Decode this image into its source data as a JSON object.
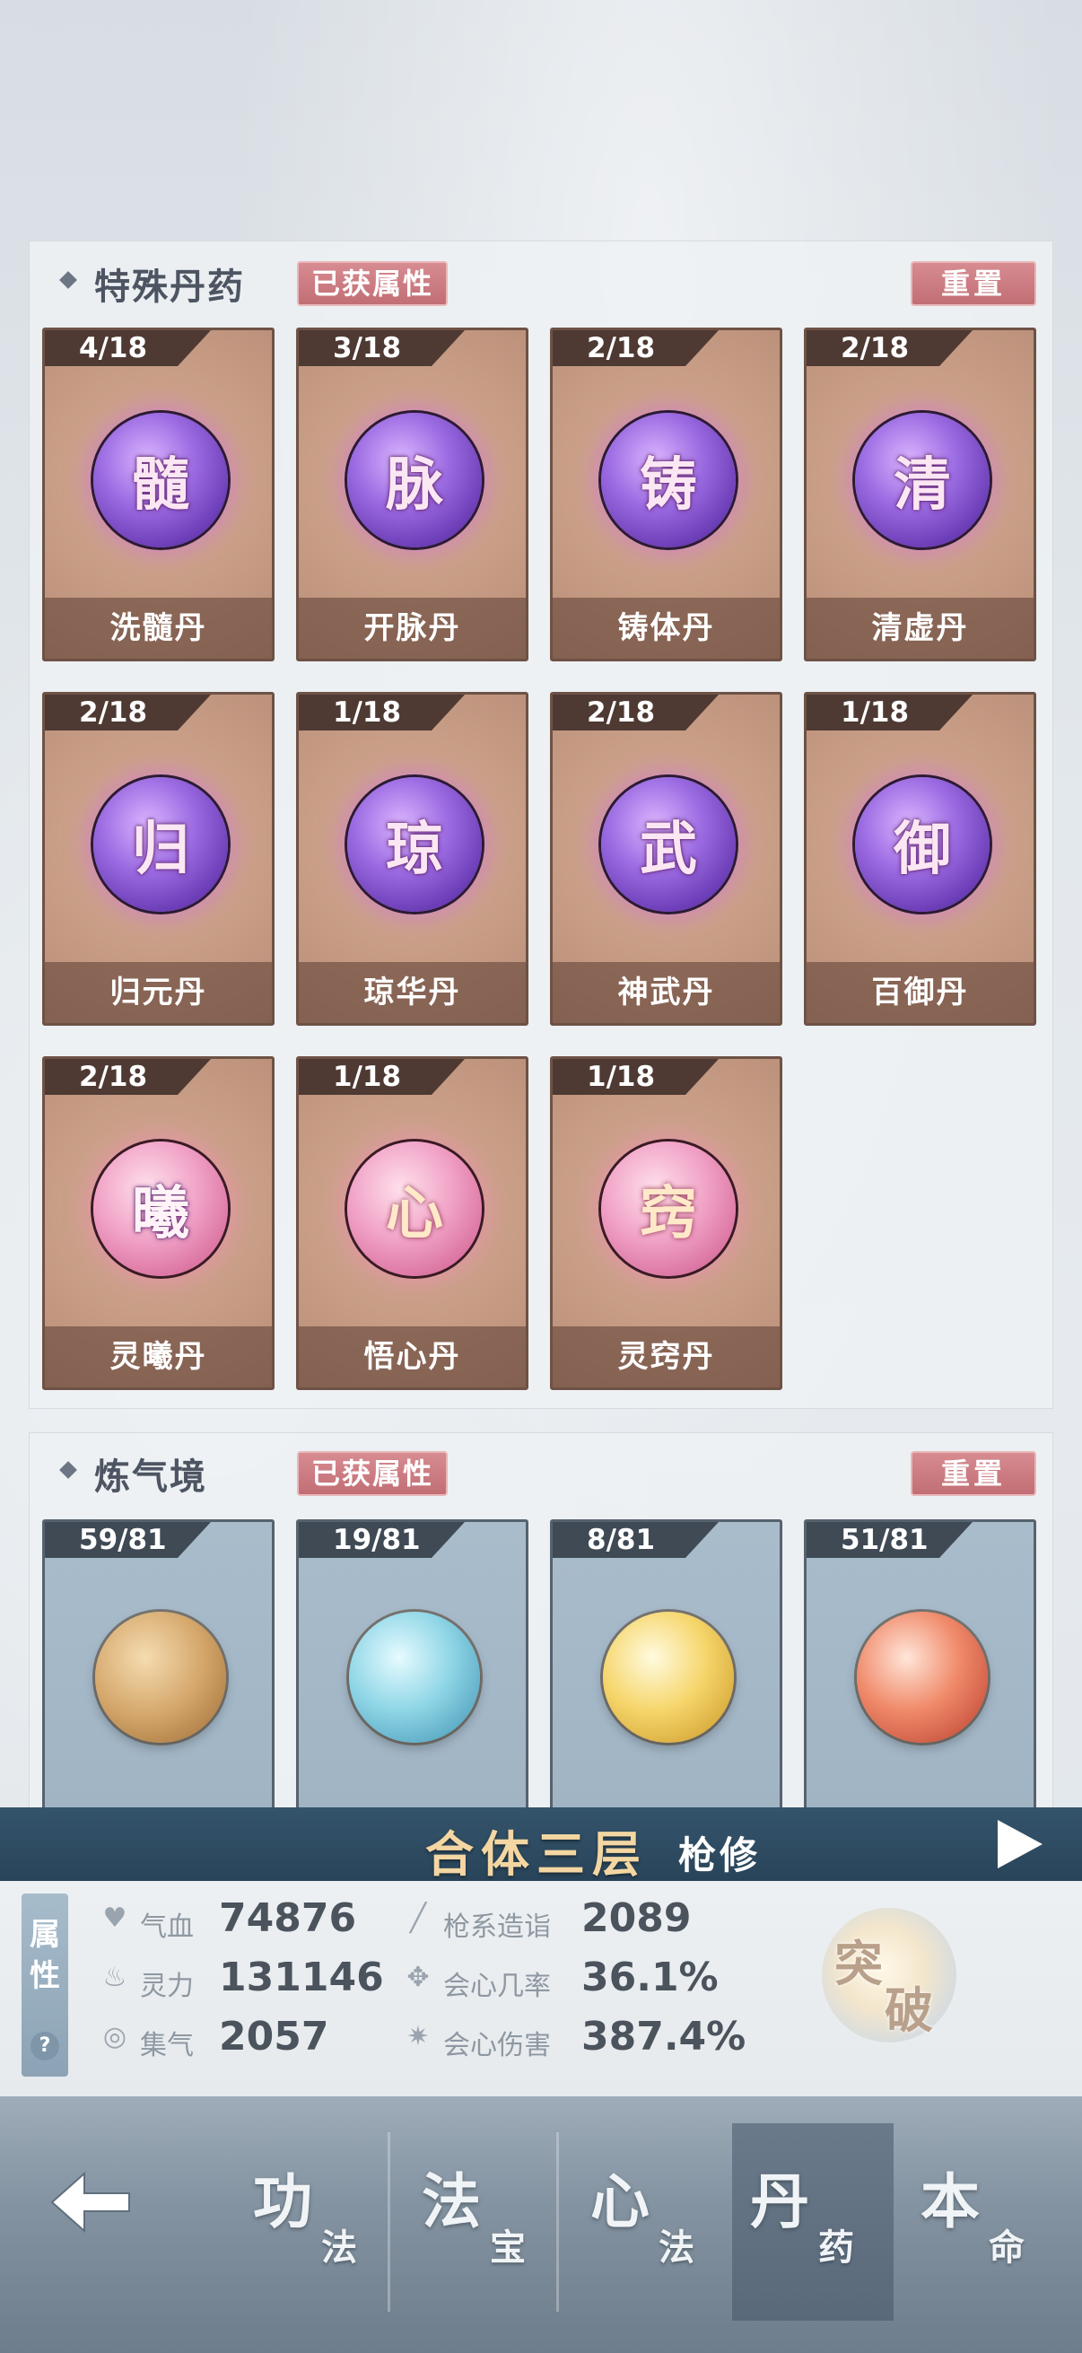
{
  "special_pills": {
    "title": "特殊丹药",
    "obtained_label": "已获属性",
    "reset_label": "重置",
    "cards": [
      {
        "count": "4/18",
        "glyph": "髓",
        "name": "洗髓丹",
        "orb": "purple"
      },
      {
        "count": "3/18",
        "glyph": "脉",
        "name": "开脉丹",
        "orb": "purple"
      },
      {
        "count": "2/18",
        "glyph": "铸",
        "name": "铸体丹",
        "orb": "purple"
      },
      {
        "count": "2/18",
        "glyph": "清",
        "name": "清虚丹",
        "orb": "purple"
      },
      {
        "count": "2/18",
        "glyph": "归",
        "name": "归元丹",
        "orb": "purple"
      },
      {
        "count": "1/18",
        "glyph": "琼",
        "name": "琼华丹",
        "orb": "purple"
      },
      {
        "count": "2/18",
        "glyph": "武",
        "name": "神武丹",
        "orb": "purple"
      },
      {
        "count": "1/18",
        "glyph": "御",
        "name": "百御丹",
        "orb": "purple"
      },
      {
        "count": "2/18",
        "glyph": "曦",
        "name": "灵曦丹",
        "orb": "pink"
      },
      {
        "count": "1/18",
        "glyph": "心",
        "name": "悟心丹",
        "orb": "pink"
      },
      {
        "count": "1/18",
        "glyph": "窍",
        "name": "灵窍丹",
        "orb": "pink"
      }
    ]
  },
  "qi_refining": {
    "title": "炼气境",
    "obtained_label": "已获属性",
    "reset_label": "重置",
    "cards": [
      {
        "count": "59/81",
        "pill": "gold-thorn-pill-icon"
      },
      {
        "count": "19/81",
        "pill": "cyan-cloud-pill-icon"
      },
      {
        "count": "8/81",
        "pill": "yellow-pill-icon"
      },
      {
        "count": "51/81",
        "pill": "red-pill-icon"
      }
    ]
  },
  "realm": {
    "level": "合体三层",
    "class": "枪修"
  },
  "attributes": {
    "tab_label_1": "属",
    "tab_label_2": "性",
    "help": "?",
    "stats": [
      {
        "icon": "heart-icon",
        "label": "气血",
        "value": "74876"
      },
      {
        "icon": "flame-icon",
        "label": "灵力",
        "value": "131146"
      },
      {
        "icon": "swirl-icon",
        "label": "集气",
        "value": "2057"
      },
      {
        "icon": "spear-icon",
        "label": "枪系造诣",
        "value": "2089"
      },
      {
        "icon": "crit-rate-icon",
        "label": "会心几率",
        "value": "36.1%"
      },
      {
        "icon": "crit-damage-icon",
        "label": "会心伤害",
        "value": "387.4%"
      }
    ],
    "breakthrough_1": "突",
    "breakthrough_2": "破"
  },
  "nav": {
    "items": [
      {
        "big": "功",
        "small": "法",
        "active": false
      },
      {
        "big": "法",
        "small": "宝",
        "active": false
      },
      {
        "big": "心",
        "small": "法",
        "active": false
      },
      {
        "big": "丹",
        "small": "药",
        "active": true
      },
      {
        "big": "本",
        "small": "命",
        "active": false
      }
    ]
  },
  "colors": {
    "tag_pink": "#c16e74",
    "banner_blue": "#294459",
    "realm_gold": "#f3d6a2"
  }
}
